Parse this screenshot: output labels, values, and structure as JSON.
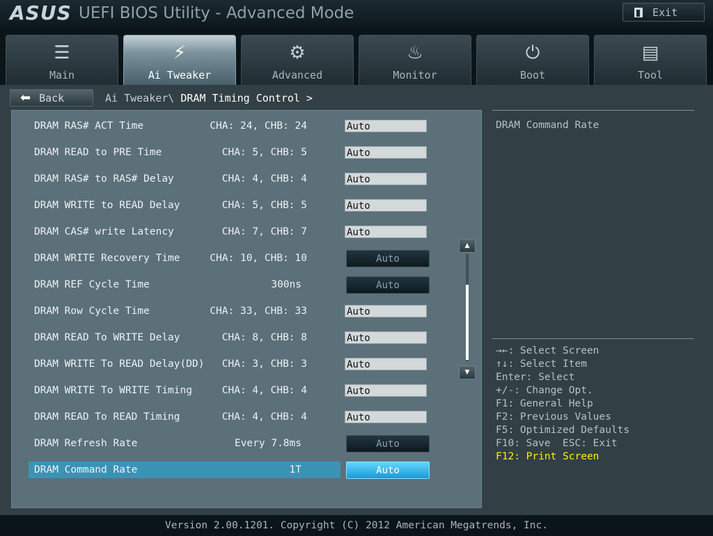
{
  "header": {
    "logo": "ASUS",
    "title": "UEFI BIOS Utility - Advanced Mode",
    "exit_label": "Exit"
  },
  "tabs": [
    {
      "label": "Main",
      "icon": "list-icon"
    },
    {
      "label": "Ai Tweaker",
      "icon": "tweaker-icon",
      "active": true
    },
    {
      "label": "Advanced",
      "icon": "advanced-icon"
    },
    {
      "label": "Monitor",
      "icon": "monitor-icon"
    },
    {
      "label": "Boot",
      "icon": "power-icon"
    },
    {
      "label": "Tool",
      "icon": "toolbox-icon"
    }
  ],
  "nav": {
    "back_label": "Back",
    "breadcrumb_parent": "Ai Tweaker\\",
    "breadcrumb_current": "DRAM Timing Control >"
  },
  "settings": [
    {
      "label": "DRAM RAS# ACT Time",
      "value": "CHA: 24, CHB: 24",
      "control": "Auto"
    },
    {
      "label": "DRAM READ to PRE Time",
      "value": "CHA:  5, CHB:  5",
      "control": "Auto"
    },
    {
      "label": "DRAM RAS# to RAS# Delay",
      "value": "CHA:  4, CHB:  4",
      "control": "Auto"
    },
    {
      "label": "DRAM WRITE to READ Delay",
      "value": "CHA:  5, CHB:  5",
      "control": "Auto"
    },
    {
      "label": "DRAM CAS# write Latency",
      "value": "CHA:  7, CHB:  7",
      "control": "Auto"
    },
    {
      "label": "DRAM WRITE Recovery Time",
      "value": "CHA: 10, CHB: 10",
      "control": "Auto"
    },
    {
      "label": "DRAM REF Cycle Time",
      "value": "300ns",
      "control": "Auto"
    },
    {
      "label": "DRAM Row Cycle Time",
      "value": "CHA: 33, CHB: 33",
      "control": "Auto"
    },
    {
      "label": "DRAM READ To WRITE Delay",
      "value": "CHA:  8, CHB:  8",
      "control": "Auto"
    },
    {
      "label": "DRAM WRITE To READ Delay(DD)",
      "value": "CHA:  3, CHB:  3",
      "control": "Auto"
    },
    {
      "label": "DRAM WRITE To WRITE Timing",
      "value": "CHA:  4, CHB:  4",
      "control": "Auto"
    },
    {
      "label": "DRAM READ To READ Timing",
      "value": "CHA:  4, CHB:  4",
      "control": "Auto"
    },
    {
      "label": "DRAM Refresh Rate",
      "value": "Every 7.8ms",
      "control": "Auto"
    },
    {
      "label": "DRAM Command Rate",
      "value": "1T",
      "control": "Auto"
    }
  ],
  "help": {
    "title": "DRAM Command Rate",
    "hotkeys": [
      "→←: Select Screen",
      "↑↓: Select Item",
      "Enter: Select",
      "+/-: Change Opt.",
      "F1: General Help",
      "F2: Previous Values",
      "F5: Optimized Defaults",
      "F10: Save  ESC: Exit",
      "F12: Print Screen"
    ]
  },
  "footer": {
    "text": "Version 2.00.1201. Copyright (C) 2012 American Megatrends, Inc."
  },
  "colors": {
    "accent": "#3a93b4",
    "selected_button": "#1d98d6",
    "highlight_text": "#fff200",
    "panel": "#5b7079"
  }
}
